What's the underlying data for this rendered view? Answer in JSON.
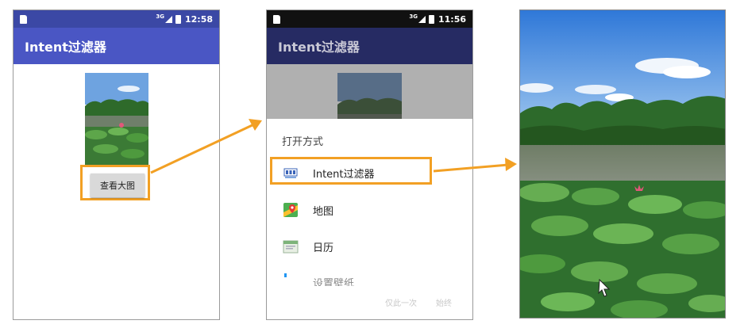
{
  "phone1": {
    "status": {
      "network": "3G",
      "time": "12:58"
    },
    "app_title": "Intent过滤器",
    "view_button": "查看大图"
  },
  "phone2": {
    "status": {
      "network": "3G",
      "time": "11:56"
    },
    "app_title": "Intent过滤器",
    "chooser": {
      "title": "打开方式",
      "items": [
        {
          "label": "Intent过滤器",
          "icon": "app-launcher-icon"
        },
        {
          "label": "地图",
          "icon": "map-pin-icon"
        },
        {
          "label": "日历",
          "icon": "calendar-icon"
        },
        {
          "label": "设置壁纸",
          "icon": "wallpaper-icon"
        }
      ],
      "actions": {
        "once": "仅此一次",
        "always": "始终"
      }
    }
  },
  "colors": {
    "highlight": "#f2a024",
    "appbar": "#4a56c4"
  }
}
